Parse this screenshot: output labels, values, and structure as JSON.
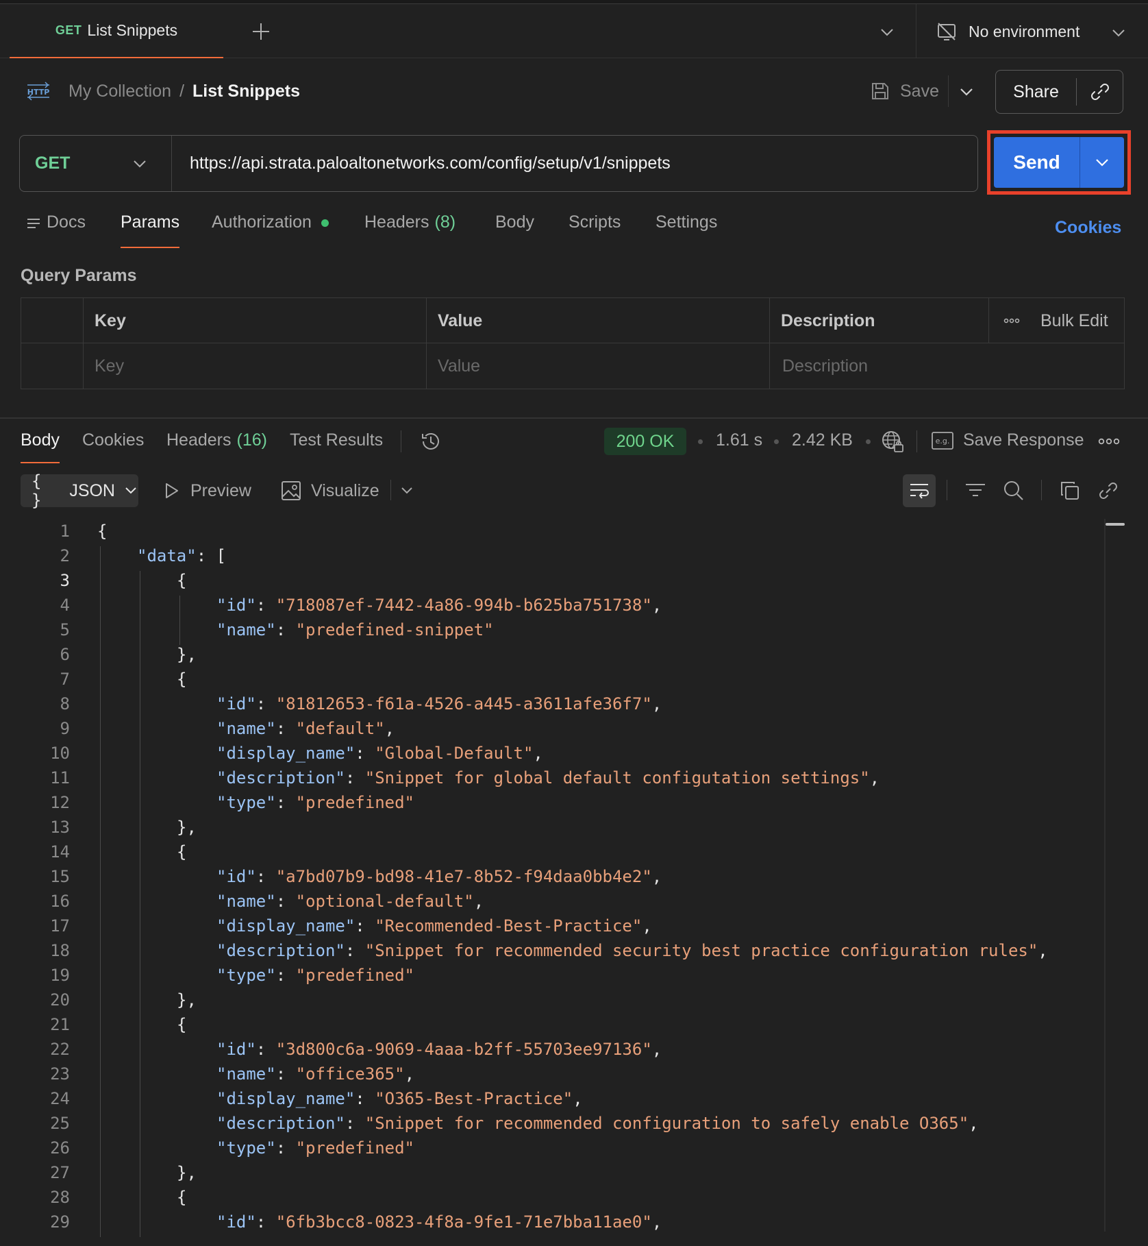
{
  "tab": {
    "method": "GET",
    "title": "List Snippets"
  },
  "environment": {
    "label": "No environment",
    "icon": "no-environment-icon"
  },
  "breadcrumb": {
    "icon": "http-icon",
    "collection": "My Collection",
    "separator": "/",
    "request": "List Snippets"
  },
  "actions": {
    "save_label": "Save",
    "share_label": "Share",
    "send_label": "Send"
  },
  "request": {
    "method": "GET",
    "url": "https://api.strata.paloaltonetworks.com/config/setup/v1/snippets"
  },
  "request_tabs": [
    {
      "label": "Docs"
    },
    {
      "label": "Params",
      "active": true
    },
    {
      "label": "Authorization",
      "indicator": "green-dot"
    },
    {
      "label": "Headers",
      "count": "(8)"
    },
    {
      "label": "Body"
    },
    {
      "label": "Scripts"
    },
    {
      "label": "Settings"
    }
  ],
  "cookies_label": "Cookies",
  "query_params": {
    "title": "Query Params",
    "headers": {
      "key": "Key",
      "value": "Value",
      "description": "Description"
    },
    "bulk_edit": "Bulk Edit",
    "placeholders": {
      "key": "Key",
      "value": "Value",
      "description": "Description"
    }
  },
  "response": {
    "tabs": [
      {
        "label": "Body",
        "active": true
      },
      {
        "label": "Cookies"
      },
      {
        "label": "Headers",
        "count": "(16)"
      },
      {
        "label": "Test Results"
      }
    ],
    "status": "200 OK",
    "time": "1.61 s",
    "size": "2.42 KB",
    "save_response": "Save Response",
    "format": "JSON",
    "format_braces": "{ }",
    "preview": "Preview",
    "visualize": "Visualize",
    "status_color": "#6fd48c",
    "accent_color": "#f26b3a",
    "send_color": "#2f6fe0"
  },
  "code_lines": [
    {
      "n": "1",
      "indent": 0,
      "parts": [
        [
          "p",
          "{"
        ]
      ]
    },
    {
      "n": "2",
      "indent": 1,
      "parts": [
        [
          "k",
          "\"data\""
        ],
        [
          "p",
          ": ["
        ]
      ]
    },
    {
      "n": "3",
      "indent": 2,
      "parts": [
        [
          "p",
          "{"
        ]
      ],
      "current": true
    },
    {
      "n": "4",
      "indent": 3,
      "parts": [
        [
          "k",
          "\"id\""
        ],
        [
          "p",
          ": "
        ],
        [
          "s",
          "\"718087ef-7442-4a86-994b-b625ba751738\""
        ],
        [
          "p",
          ","
        ]
      ]
    },
    {
      "n": "5",
      "indent": 3,
      "parts": [
        [
          "k",
          "\"name\""
        ],
        [
          "p",
          ": "
        ],
        [
          "s",
          "\"predefined-snippet\""
        ]
      ]
    },
    {
      "n": "6",
      "indent": 2,
      "parts": [
        [
          "p",
          "},"
        ]
      ]
    },
    {
      "n": "7",
      "indent": 2,
      "parts": [
        [
          "p",
          "{"
        ]
      ]
    },
    {
      "n": "8",
      "indent": 3,
      "parts": [
        [
          "k",
          "\"id\""
        ],
        [
          "p",
          ": "
        ],
        [
          "s",
          "\"81812653-f61a-4526-a445-a3611afe36f7\""
        ],
        [
          "p",
          ","
        ]
      ]
    },
    {
      "n": "9",
      "indent": 3,
      "parts": [
        [
          "k",
          "\"name\""
        ],
        [
          "p",
          ": "
        ],
        [
          "s",
          "\"default\""
        ],
        [
          "p",
          ","
        ]
      ]
    },
    {
      "n": "10",
      "indent": 3,
      "parts": [
        [
          "k",
          "\"display_name\""
        ],
        [
          "p",
          ": "
        ],
        [
          "s",
          "\"Global-Default\""
        ],
        [
          "p",
          ","
        ]
      ]
    },
    {
      "n": "11",
      "indent": 3,
      "parts": [
        [
          "k",
          "\"description\""
        ],
        [
          "p",
          ": "
        ],
        [
          "s",
          "\"Snippet for global default configutation settings\""
        ],
        [
          "p",
          ","
        ]
      ]
    },
    {
      "n": "12",
      "indent": 3,
      "parts": [
        [
          "k",
          "\"type\""
        ],
        [
          "p",
          ": "
        ],
        [
          "s",
          "\"predefined\""
        ]
      ]
    },
    {
      "n": "13",
      "indent": 2,
      "parts": [
        [
          "p",
          "},"
        ]
      ]
    },
    {
      "n": "14",
      "indent": 2,
      "parts": [
        [
          "p",
          "{"
        ]
      ]
    },
    {
      "n": "15",
      "indent": 3,
      "parts": [
        [
          "k",
          "\"id\""
        ],
        [
          "p",
          ": "
        ],
        [
          "s",
          "\"a7bd07b9-bd98-41e7-8b52-f94daa0bb4e2\""
        ],
        [
          "p",
          ","
        ]
      ]
    },
    {
      "n": "16",
      "indent": 3,
      "parts": [
        [
          "k",
          "\"name\""
        ],
        [
          "p",
          ": "
        ],
        [
          "s",
          "\"optional-default\""
        ],
        [
          "p",
          ","
        ]
      ]
    },
    {
      "n": "17",
      "indent": 3,
      "parts": [
        [
          "k",
          "\"display_name\""
        ],
        [
          "p",
          ": "
        ],
        [
          "s",
          "\"Recommended-Best-Practice\""
        ],
        [
          "p",
          ","
        ]
      ]
    },
    {
      "n": "18",
      "indent": 3,
      "parts": [
        [
          "k",
          "\"description\""
        ],
        [
          "p",
          ": "
        ],
        [
          "s",
          "\"Snippet for recommended security best practice configuration rules\""
        ],
        [
          "p",
          ","
        ]
      ]
    },
    {
      "n": "19",
      "indent": 3,
      "parts": [
        [
          "k",
          "\"type\""
        ],
        [
          "p",
          ": "
        ],
        [
          "s",
          "\"predefined\""
        ]
      ]
    },
    {
      "n": "20",
      "indent": 2,
      "parts": [
        [
          "p",
          "},"
        ]
      ]
    },
    {
      "n": "21",
      "indent": 2,
      "parts": [
        [
          "p",
          "{"
        ]
      ]
    },
    {
      "n": "22",
      "indent": 3,
      "parts": [
        [
          "k",
          "\"id\""
        ],
        [
          "p",
          ": "
        ],
        [
          "s",
          "\"3d800c6a-9069-4aaa-b2ff-55703ee97136\""
        ],
        [
          "p",
          ","
        ]
      ]
    },
    {
      "n": "23",
      "indent": 3,
      "parts": [
        [
          "k",
          "\"name\""
        ],
        [
          "p",
          ": "
        ],
        [
          "s",
          "\"office365\""
        ],
        [
          "p",
          ","
        ]
      ]
    },
    {
      "n": "24",
      "indent": 3,
      "parts": [
        [
          "k",
          "\"display_name\""
        ],
        [
          "p",
          ": "
        ],
        [
          "s",
          "\"O365-Best-Practice\""
        ],
        [
          "p",
          ","
        ]
      ]
    },
    {
      "n": "25",
      "indent": 3,
      "parts": [
        [
          "k",
          "\"description\""
        ],
        [
          "p",
          ": "
        ],
        [
          "s",
          "\"Snippet for recommended configuration to safely enable O365\""
        ],
        [
          "p",
          ","
        ]
      ]
    },
    {
      "n": "26",
      "indent": 3,
      "parts": [
        [
          "k",
          "\"type\""
        ],
        [
          "p",
          ": "
        ],
        [
          "s",
          "\"predefined\""
        ]
      ]
    },
    {
      "n": "27",
      "indent": 2,
      "parts": [
        [
          "p",
          "},"
        ]
      ]
    },
    {
      "n": "28",
      "indent": 2,
      "parts": [
        [
          "p",
          "{"
        ]
      ]
    },
    {
      "n": "29",
      "indent": 3,
      "parts": [
        [
          "k",
          "\"id\""
        ],
        [
          "p",
          ": "
        ],
        [
          "s",
          "\"6fb3bcc8-0823-4f8a-9fe1-71e7bba11ae0\""
        ],
        [
          "p",
          ","
        ]
      ]
    }
  ]
}
